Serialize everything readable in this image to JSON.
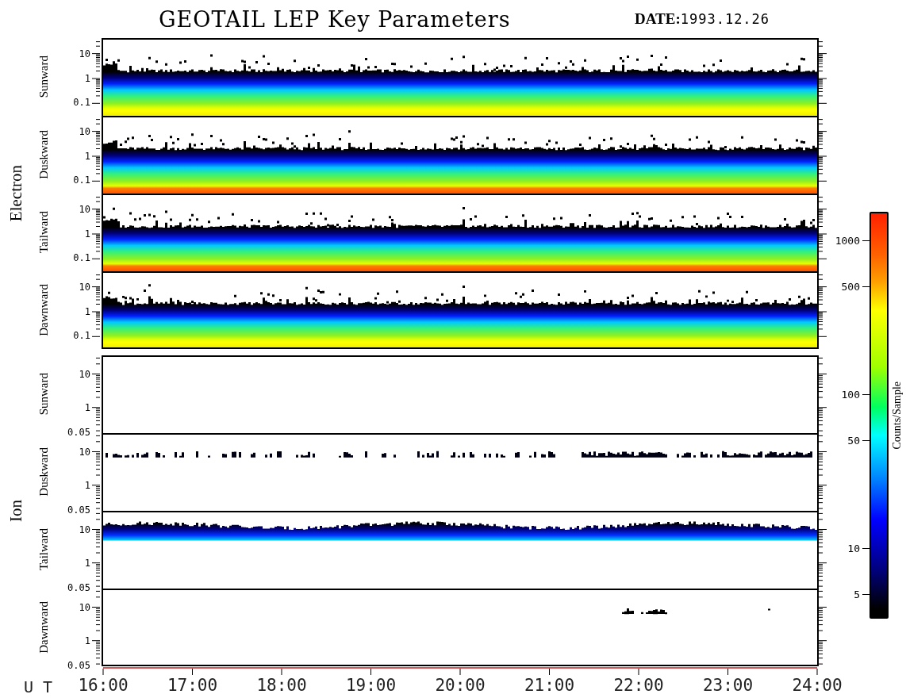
{
  "title": "GEOTAIL LEP Key Parameters",
  "date": {
    "label": "DATE:",
    "value": "1993.12.26"
  },
  "groups": [
    {
      "name": "Electron",
      "panels": [
        {
          "label": "Sunward",
          "kind": "full",
          "yticks": [
            "10",
            "1",
            "0.1"
          ]
        },
        {
          "label": "Duskward",
          "kind": "full-hot",
          "yticks": [
            "10",
            "1",
            "0.1"
          ]
        },
        {
          "label": "Tailward",
          "kind": "full-hot",
          "yticks": [
            "10",
            "1",
            "0.1"
          ]
        },
        {
          "label": "Dawnward",
          "kind": "full",
          "yticks": [
            "10",
            "1",
            "0.1"
          ]
        }
      ]
    },
    {
      "name": "Ion",
      "panels": [
        {
          "label": "Sunward",
          "kind": "none",
          "yticks": [
            "10",
            "1",
            "0.05"
          ]
        },
        {
          "label": "Duskward",
          "kind": "speckle",
          "yticks": [
            "10",
            "1",
            "0.05"
          ]
        },
        {
          "label": "Tailward",
          "kind": "band",
          "yticks": [
            "10",
            "1",
            "0.05"
          ]
        },
        {
          "label": "Dawnward",
          "kind": "trace",
          "yticks": [
            "10",
            "1",
            "0.05"
          ]
        }
      ]
    }
  ],
  "time_axis": {
    "label": "U T",
    "ticks": [
      "16:00",
      "17:00",
      "18:00",
      "19:00",
      "20:00",
      "21:00",
      "22:00",
      "23:00",
      "24:00"
    ]
  },
  "colorbar": {
    "title": "Counts/Sample",
    "ticks": [
      "1000",
      "500",
      "100",
      "50",
      "10",
      "5"
    ]
  }
}
